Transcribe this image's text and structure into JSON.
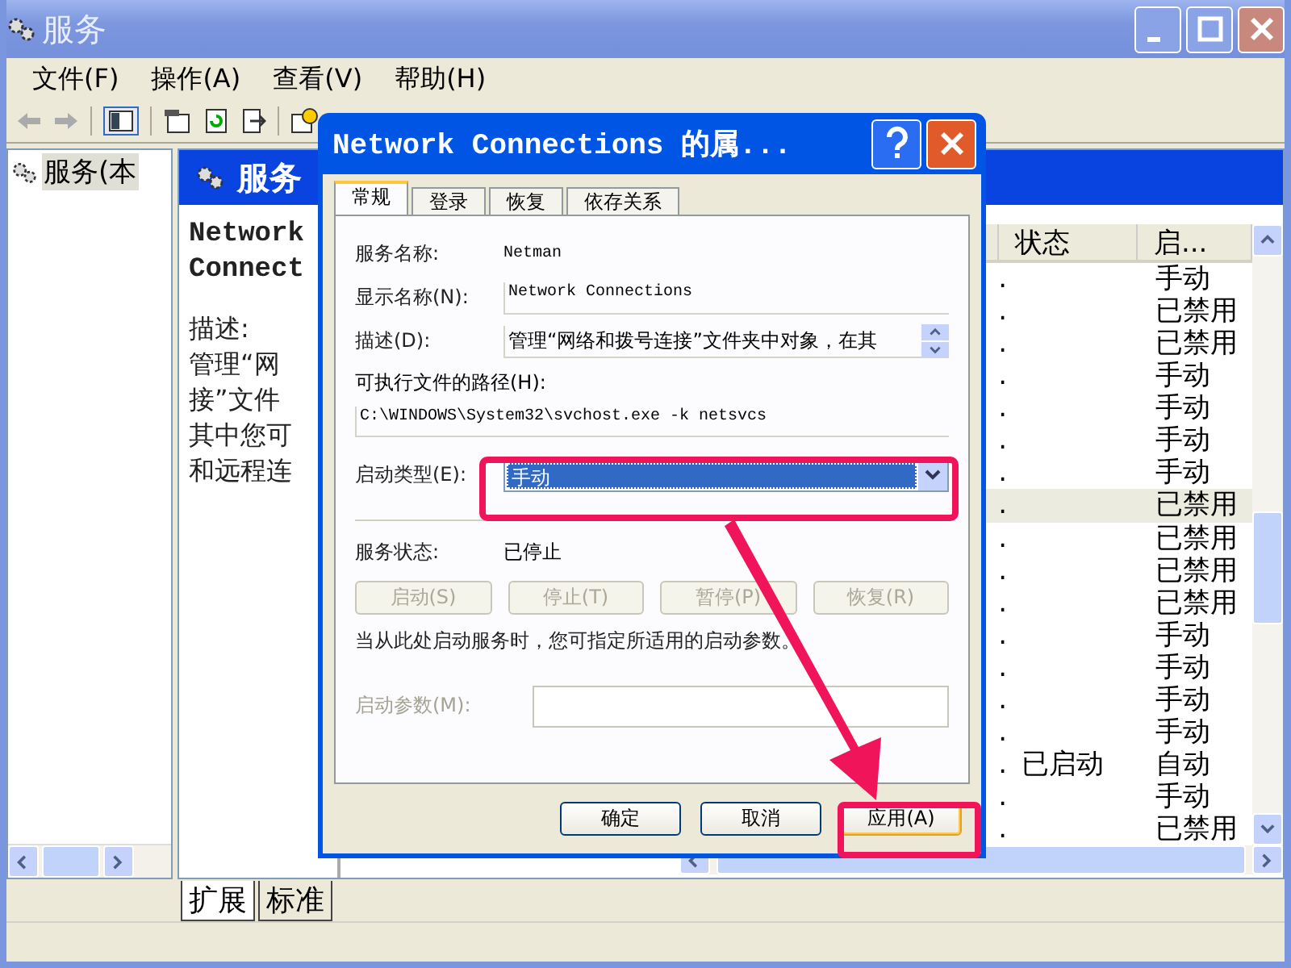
{
  "window": {
    "title": "服务"
  },
  "menu": [
    "文件(F)",
    "操作(A)",
    "查看(V)",
    "帮助(H)"
  ],
  "tree": {
    "items": [
      {
        "label": "服务(本",
        "selected": true
      }
    ]
  },
  "header": {
    "title": "服务"
  },
  "description_panel": {
    "name_lines": [
      "Network",
      "Connect"
    ],
    "lines": [
      "描述:",
      "管理“网",
      "接”文件",
      "其中您可",
      "和远程连"
    ]
  },
  "list": {
    "columns": [
      "状态",
      "启..."
    ],
    "rows": [
      {
        "column_1": ".",
        "startup": "手动",
        "selected": false
      },
      {
        "column_1": ".",
        "startup": "已禁用",
        "selected": false
      },
      {
        "column_1": ".",
        "startup": "已禁用",
        "selected": false
      },
      {
        "column_1": ".",
        "startup": "手动",
        "selected": false
      },
      {
        "column_1": ".",
        "startup": "手动",
        "selected": false
      },
      {
        "column_1": ".",
        "startup": "手动",
        "selected": false
      },
      {
        "column_1": ".",
        "startup": "手动",
        "selected": false
      },
      {
        "column_1": ".",
        "startup": "已禁用",
        "selected": true
      },
      {
        "column_1": ".",
        "startup": "已禁用",
        "selected": false
      },
      {
        "column_1": ".",
        "startup": "已禁用",
        "selected": false
      },
      {
        "column_1": ".",
        "startup": "已禁用",
        "selected": false
      },
      {
        "column_1": ".",
        "startup": "手动",
        "selected": false
      },
      {
        "column_1": ".",
        "startup": "手动",
        "selected": false
      },
      {
        "column_1": ".",
        "startup": "手动",
        "selected": false
      },
      {
        "column_1": ".",
        "startup": "手动",
        "selected": false
      },
      {
        "column_1": ".",
        "status": "已启动",
        "startup": "自动",
        "selected": false
      },
      {
        "column_1": ".",
        "startup": "手动",
        "selected": false
      },
      {
        "column_1": ".",
        "startup": "已禁用",
        "selected": false
      }
    ]
  },
  "bottom_tabs": [
    {
      "label": "扩展",
      "selected": true
    },
    {
      "label": "标准",
      "selected": false
    }
  ],
  "dialog": {
    "title": "Network Connections 的属...",
    "tabs": [
      {
        "label": "常规",
        "selected": true
      },
      {
        "label": "登录",
        "selected": false
      },
      {
        "label": "恢复",
        "selected": false
      },
      {
        "label": "依存关系",
        "selected": false
      }
    ],
    "service_name": {
      "label": "服务名称:",
      "value": "Netman"
    },
    "display_name": {
      "label": "显示名称(N):",
      "value": "Network Connections"
    },
    "description": {
      "label": "描述(D):",
      "value": "管理“网络和拨号连接”文件夹中对象，在其"
    },
    "path": {
      "label": "可执行文件的路径(H):",
      "value": "C:\\WINDOWS\\System32\\svchost.exe -k netsvcs"
    },
    "startup_type": {
      "label": "启动类型(E):",
      "value": "手动"
    },
    "service_status": {
      "label": "服务状态:",
      "value": "已停止"
    },
    "control_buttons": [
      {
        "label": "启动(S)",
        "disabled": true
      },
      {
        "label": "停止(T)",
        "disabled": true
      },
      {
        "label": "暂停(P)",
        "disabled": true
      },
      {
        "label": "恢复(R)",
        "disabled": true
      }
    ],
    "hint": "当从此处启动服务时，您可指定所适用的启动参数。",
    "start_params": {
      "label": "启动参数(M):",
      "disabled": true
    },
    "buttons": [
      {
        "label": "确定",
        "focused": false
      },
      {
        "label": "取消",
        "focused": false
      },
      {
        "label": "应用(A)",
        "focused": true
      }
    ]
  }
}
